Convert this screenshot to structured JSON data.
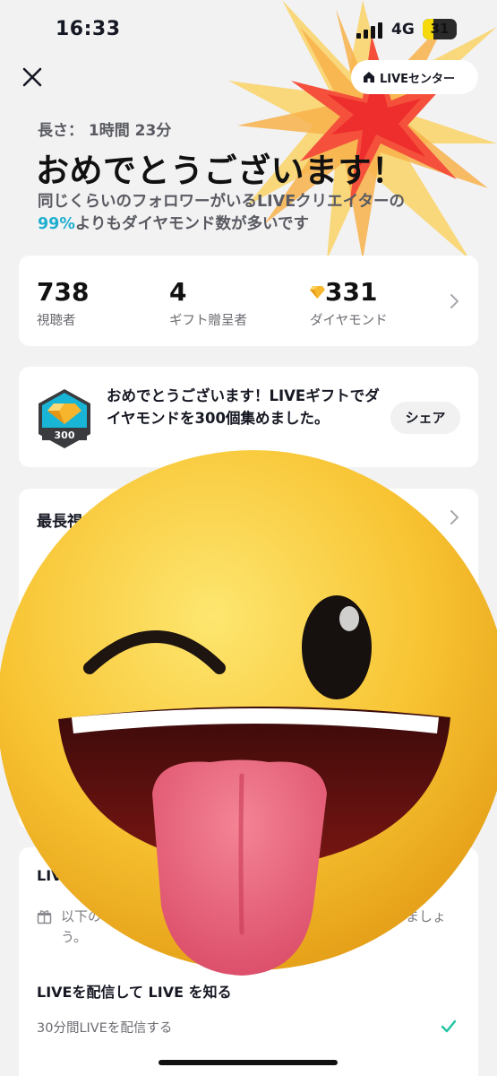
{
  "status_bar": {
    "time": "16:33",
    "network": "4G",
    "battery": "31",
    "battery_level": 0.31,
    "battery_color": "#f5d90a"
  },
  "header": {
    "close_icon": "close-icon",
    "live_center_label": "LIVEセンター",
    "live_center_icon": "home-icon"
  },
  "summary": {
    "duration_label": "長さ：",
    "duration_value": "1時間 23分",
    "headline": "おめでとうございます！",
    "subtext_line1": "同じくらいのフォロワーがいるLIVEクリエイターの",
    "subtext_percent": "99%",
    "subtext_line2_rest": "よりもダイヤモンド数が多いです",
    "accent_color": "#20aecf"
  },
  "stats": {
    "viewers_value": "738",
    "viewers_label": "視聴者",
    "gifters_value": "4",
    "gifters_label": "ギフト贈呈者",
    "diamonds_value": "331",
    "diamonds_label": "ダイヤモンド",
    "diamond_icon": "diamond-icon"
  },
  "badge_card": {
    "badge_number": "300",
    "message": "おめでとうございます！LIVEギフトでダイヤモンドを300個集めました。",
    "share_label": "シェア"
  },
  "longest_card": {
    "title": "最長視"
  },
  "bottom_card": {
    "title": "LIV",
    "gift_text": "以下の",
    "gift_text_end": "を増やしましょう。",
    "task_heading": "LIVEを配信して LIVE を知る",
    "task_item": "30分間LIVEを配信する",
    "task_done": true
  },
  "overlay": {
    "emoji": "winking-face-with-tongue-emoji"
  }
}
